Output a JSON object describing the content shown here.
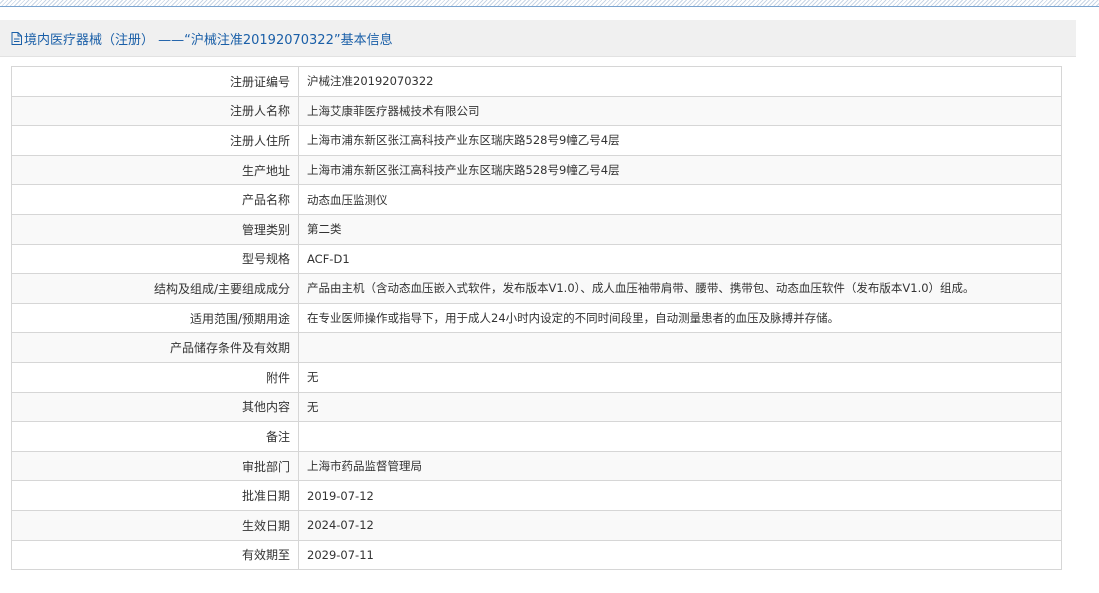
{
  "panel": {
    "title": "境内医疗器械（注册） ——“沪械注准20192070322”基本信息",
    "title_color": "#1a5fa8",
    "icon": "document-icon"
  },
  "rows": [
    {
      "label": "注册证编号",
      "value": "沪械注准20192070322"
    },
    {
      "label": "注册人名称",
      "value": "上海艾康菲医疗器械技术有限公司"
    },
    {
      "label": "注册人住所",
      "value": "上海市浦东新区张江高科技产业东区瑞庆路528号9幢乙号4层"
    },
    {
      "label": "生产地址",
      "value": "上海市浦东新区张江高科技产业东区瑞庆路528号9幢乙号4层"
    },
    {
      "label": "产品名称",
      "value": "动态血压监测仪"
    },
    {
      "label": "管理类别",
      "value": "第二类"
    },
    {
      "label": "型号规格",
      "value": "ACF-D1"
    },
    {
      "label": "结构及组成/主要组成成分",
      "value": "产品由主机（含动态血压嵌入式软件，发布版本V1.0）、成人血压袖带肩带、腰带、携带包、动态血压软件（发布版本V1.0）组成。"
    },
    {
      "label": "适用范围/预期用途",
      "value": "在专业医师操作或指导下，用于成人24小时内设定的不同时间段里，自动测量患者的血压及脉搏并存储。"
    },
    {
      "label": "产品储存条件及有效期",
      "value": ""
    },
    {
      "label": "附件",
      "value": "无"
    },
    {
      "label": "其他内容",
      "value": "无"
    },
    {
      "label": "备注",
      "value": ""
    },
    {
      "label": "审批部门",
      "value": "上海市药品监督管理局"
    },
    {
      "label": "批准日期",
      "value": "2019-07-12"
    },
    {
      "label": "生效日期",
      "value": "2024-07-12"
    },
    {
      "label": "有效期至",
      "value": "2029-07-11"
    }
  ]
}
